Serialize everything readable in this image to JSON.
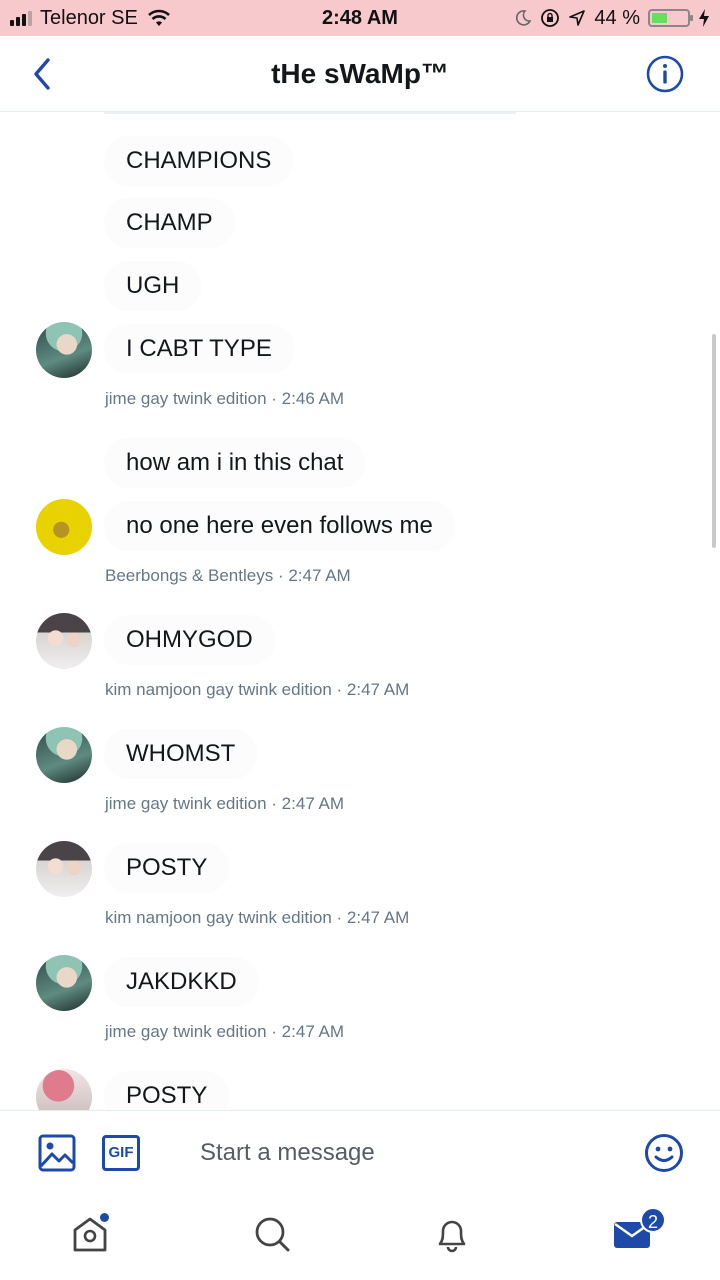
{
  "status_bar": {
    "carrier": "Telenor SE",
    "time": "2:48 AM",
    "battery": "44 %",
    "battery_level": 0.44
  },
  "header": {
    "title": "tHe sWaMp™"
  },
  "messages": [
    {
      "text": "CHAMPIONS"
    },
    {
      "text": "CHAMP"
    },
    {
      "text": "UGH"
    },
    {
      "text": "I CABT TYPE"
    },
    {
      "meta": "jime gay twink edition · 2:46 AM"
    },
    {
      "text": "how am i in this chat"
    },
    {
      "text": "no one here even follows me"
    },
    {
      "meta": "Beerbongs & Bentleys · 2:47 AM"
    },
    {
      "text": "OHMYGOD"
    },
    {
      "meta": "kim namjoon gay twink edition · 2:47 AM"
    },
    {
      "text": "WHOMST"
    },
    {
      "meta": "jime gay twink edition · 2:47 AM"
    },
    {
      "text": "POSTY"
    },
    {
      "meta": "kim namjoon gay twink edition · 2:47 AM"
    },
    {
      "text": "JAKDKKD"
    },
    {
      "meta": "jime gay twink edition · 2:47 AM"
    },
    {
      "text": "POSTY"
    }
  ],
  "composer": {
    "placeholder": "Start a message",
    "gif_label": "GIF"
  },
  "tabbar": {
    "messages_badge": "2"
  },
  "colors": {
    "accent": "#1d4aa8",
    "status_bar": "#f8c9cc",
    "meta_text": "#657786"
  }
}
